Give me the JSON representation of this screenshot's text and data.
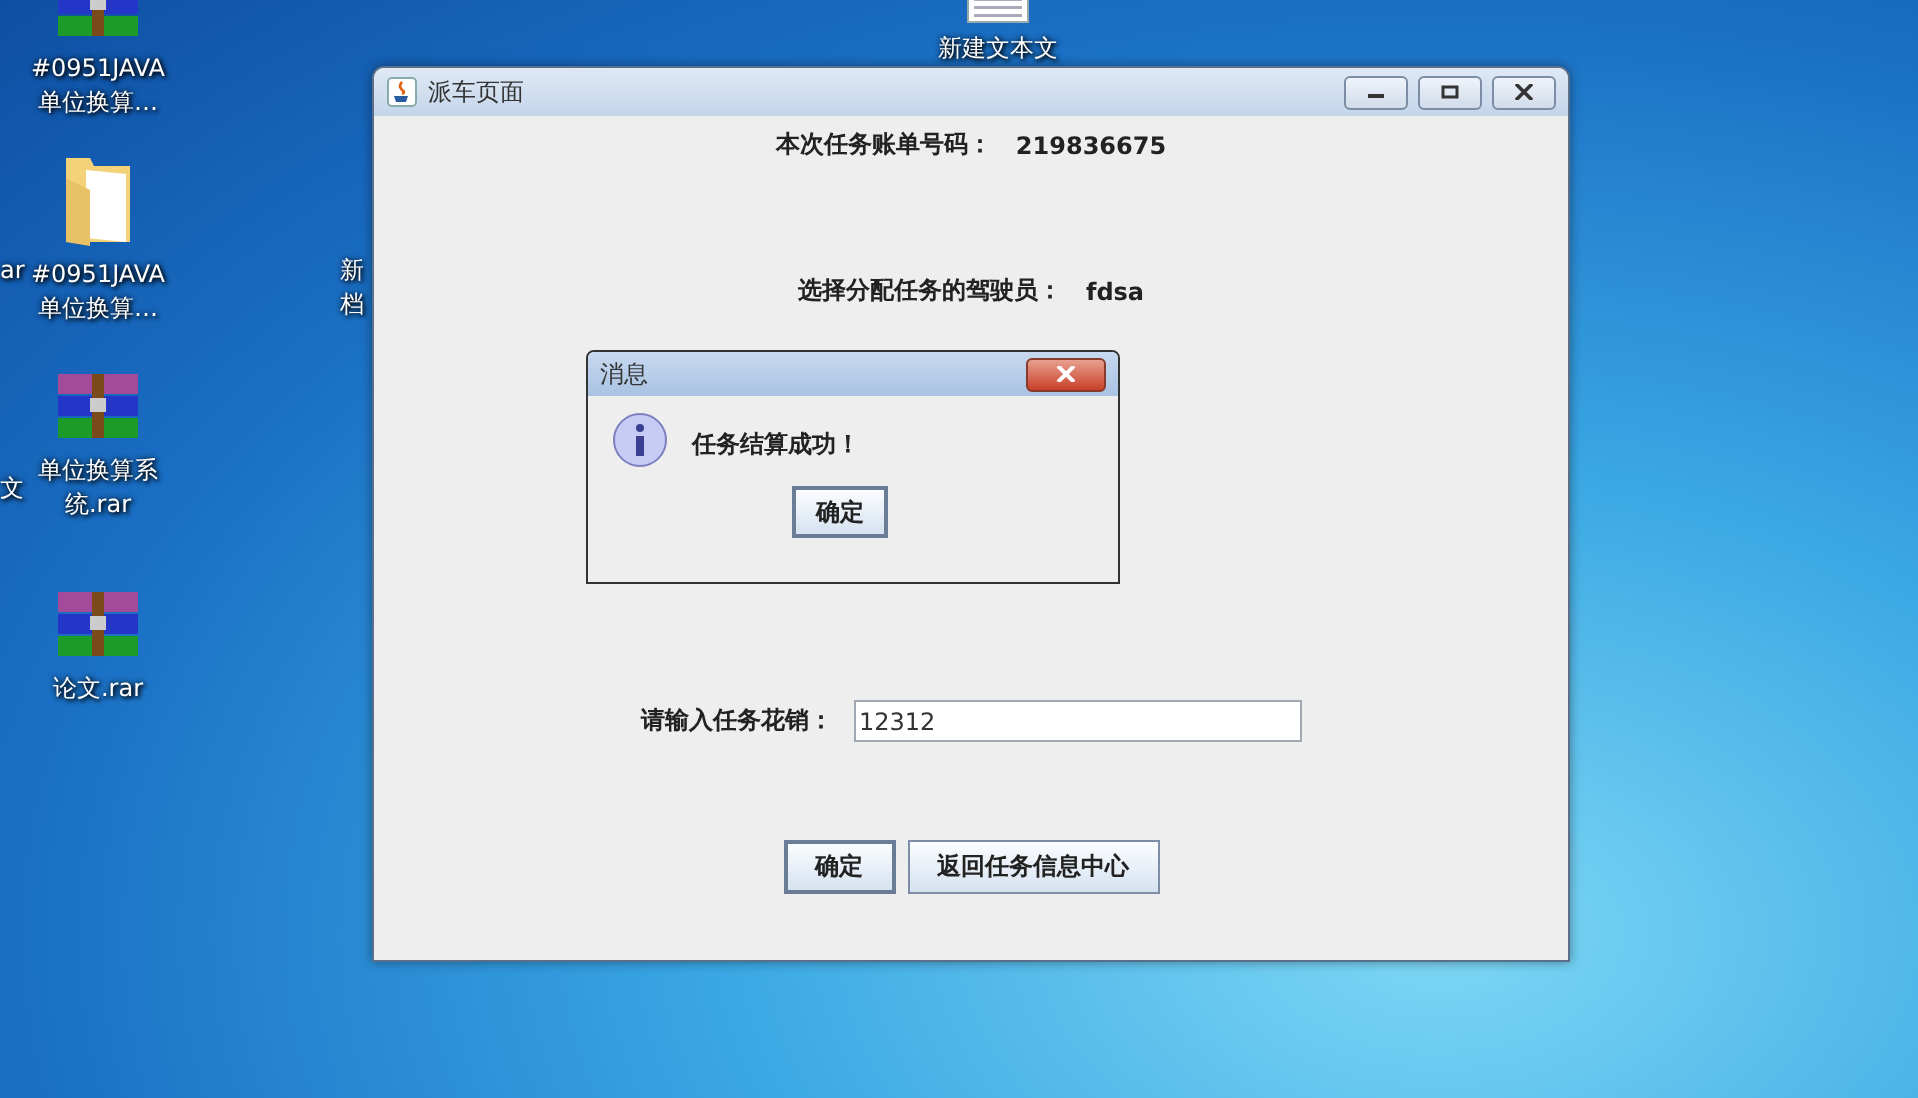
{
  "desktop_icons": [
    {
      "kind": "rar",
      "lines": [
        "#0951JAVA",
        "单位换算…"
      ]
    },
    {
      "kind": "folder",
      "lines": [
        "#0951JAVA",
        "单位换算…"
      ]
    },
    {
      "kind": "rar",
      "lines": [
        "单位换算系",
        "统.rar"
      ]
    },
    {
      "kind": "rar",
      "lines": [
        "论文.rar"
      ]
    },
    {
      "kind": "text",
      "lines": [
        "新建文本文"
      ]
    }
  ],
  "edge_labels": [
    "ar",
    "文"
  ],
  "hidden_labels": [
    "新",
    "档"
  ],
  "window": {
    "title": "派车页面",
    "bill": {
      "label": "本次任务账单号码：",
      "value": "219836675"
    },
    "driver": {
      "label": "选择分配任务的驾驶员：",
      "value": "fdsa"
    },
    "cost": {
      "label": "请输入任务花销：",
      "value": "12312"
    },
    "buttons": [
      {
        "label": "确定",
        "focused": true
      },
      {
        "label": "返回任务信息中心",
        "focused": false
      }
    ]
  },
  "dialog": {
    "title": "消息",
    "message": "任务结算成功！",
    "button": "确定"
  }
}
